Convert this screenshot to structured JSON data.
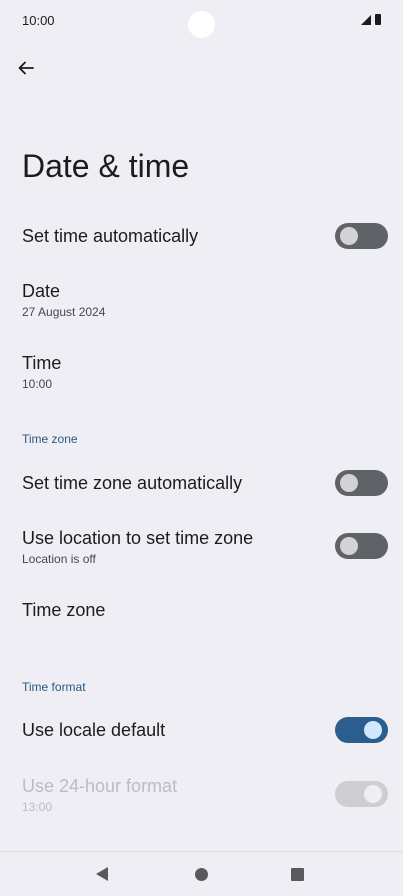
{
  "status_bar": {
    "time": "10:00"
  },
  "header": {
    "title": "Date & time"
  },
  "settings": {
    "set_time_auto": {
      "label": "Set time automatically",
      "enabled": false
    },
    "date": {
      "label": "Date",
      "value": "27 August 2024"
    },
    "time": {
      "label": "Time",
      "value": "10:00"
    },
    "time_zone_section": "Time zone",
    "set_zone_auto": {
      "label": "Set time zone automatically",
      "enabled": false
    },
    "use_location": {
      "label": "Use location to set time zone",
      "sub": "Location is off",
      "enabled": false
    },
    "time_zone": {
      "label": "Time zone"
    },
    "time_format_section": "Time format",
    "use_locale": {
      "label": "Use locale default",
      "enabled": true
    },
    "use_24h": {
      "label": "Use 24-hour format",
      "sub": "13:00",
      "enabled": true,
      "disabled": true
    }
  },
  "icons": {
    "back": "arrow-back-icon",
    "nav_back": "nav-back-icon",
    "nav_home": "nav-home-icon",
    "nav_recents": "nav-recents-icon"
  },
  "colors": {
    "background": "#f0eef5",
    "accent": "#2b5e8c",
    "section_label": "#2a5a80"
  }
}
